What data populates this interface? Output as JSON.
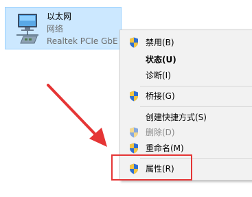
{
  "adapter": {
    "name": "以太网",
    "status": "网络",
    "device": "Realtek PCIe GbE F"
  },
  "context_menu": {
    "items": [
      {
        "label": "禁用(B)",
        "icon": "shield-icon"
      },
      {
        "label": "状态(U)",
        "icon": ""
      },
      {
        "label": "诊断(I)",
        "icon": ""
      },
      {
        "label": "桥接(G)",
        "icon": "shield-icon"
      },
      {
        "label": "创建快捷方式(S)",
        "icon": ""
      },
      {
        "label": "删除(D)",
        "icon": "shield-icon",
        "disabled": true
      },
      {
        "label": "重命名(M)",
        "icon": "shield-icon"
      },
      {
        "label": "属性(R)",
        "icon": "shield-icon"
      }
    ]
  },
  "annotation": {
    "arrow_color": "#e53535",
    "highlight_color": "#e53535"
  },
  "colors": {
    "selection_bg": "#cce8ff",
    "menu_bg": "#f2f2f2"
  }
}
